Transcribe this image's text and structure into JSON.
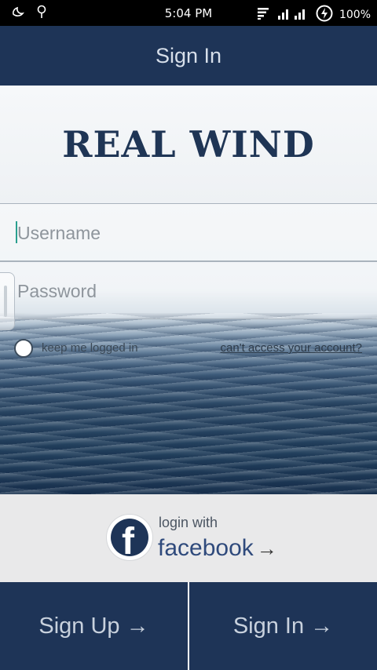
{
  "status_bar": {
    "time": "5:04 PM",
    "battery": "100%"
  },
  "app_bar": {
    "title": "Sign In"
  },
  "brand": {
    "title": "REAL WIND"
  },
  "form": {
    "username_placeholder": "Username",
    "password_placeholder": "Password",
    "keep_logged_in_label": "keep me logged in",
    "cant_access_label": "can't access your account?"
  },
  "facebook": {
    "login_with": "login with",
    "facebook_label": "facebook",
    "arrow": "→",
    "icon_letter": "f"
  },
  "bottom": {
    "sign_up_label": "Sign Up →",
    "sign_in_label": "Sign In →"
  },
  "colors": {
    "primary_navy": "#1e3457",
    "brand_text": "#1f3555",
    "facebook_blue": "#2f4a7c"
  }
}
